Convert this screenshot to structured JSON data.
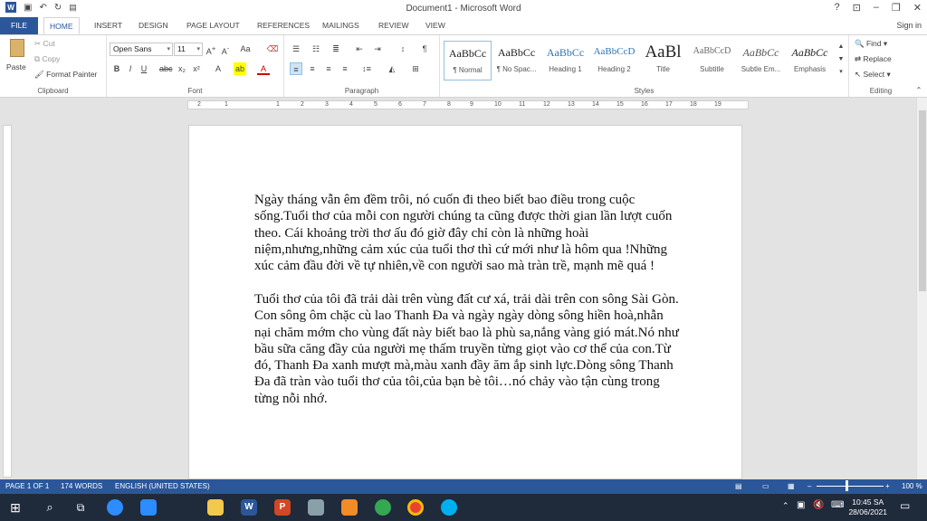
{
  "window": {
    "title": "Document1 - Microsoft Word",
    "help": "?",
    "sign_in": "Sign in"
  },
  "tabs": [
    "FILE",
    "HOME",
    "INSERT",
    "DESIGN",
    "PAGE LAYOUT",
    "REFERENCES",
    "MAILINGS",
    "REVIEW",
    "VIEW"
  ],
  "ribbon": {
    "clipboard": {
      "paste": "Paste",
      "cut": "Cut",
      "copy": "Copy",
      "format_painter": "Format Painter",
      "label": "Clipboard"
    },
    "font": {
      "name": "Open Sans",
      "size": "11",
      "label": "Font"
    },
    "paragraph": {
      "label": "Paragraph"
    },
    "styles": {
      "label": "Styles",
      "items": [
        {
          "sample": "AaBbCc",
          "name": "¶ Normal"
        },
        {
          "sample": "AaBbCc",
          "name": "¶ No Spac..."
        },
        {
          "sample": "AaBbCc",
          "name": "Heading 1"
        },
        {
          "sample": "AaBbCcD",
          "name": "Heading 2"
        },
        {
          "sample": "AaBl",
          "name": "Title"
        },
        {
          "sample": "AaBbCcD",
          "name": "Subtitle"
        },
        {
          "sample": "AaBbCc",
          "name": "Subtle Em..."
        },
        {
          "sample": "AaBbCc",
          "name": "Emphasis"
        }
      ]
    },
    "editing": {
      "find": "Find",
      "replace": "Replace",
      "select": "Select",
      "label": "Editing"
    }
  },
  "ruler_numbers": [
    "2",
    "1",
    "1",
    "2",
    "3",
    "4",
    "5",
    "6",
    "7",
    "8",
    "9",
    "10",
    "11",
    "12",
    "13",
    "14",
    "15",
    "16",
    "17",
    "18",
    "19"
  ],
  "document": {
    "paragraph1": "Ngày tháng vẫn êm đềm trôi, nó cuốn đi theo biết bao điều trong cuộc sống.Tuổi thơ của mỗi con người chúng ta cũng được thời gian lần lượt cuốn theo. Cái khoảng trời thơ ấu đó giờ đây chỉ còn là những hoài niệm,nhưng,những cảm xúc của tuổi thơ thì cứ mới như là hôm qua !Những xúc cảm đầu đời về tự nhiên,về con người sao mà tràn trề, mạnh mẽ quá !",
    "paragraph2": "Tuổi thơ của tôi đã trải dài trên vùng đất cư xá, trải dài trên con sông Sài Gòn. Con sông ôm chặc cù lao Thanh Đa và ngày ngày dòng sông hiền hoà,nhẫn nại chăm mớm cho vùng đất này biết bao là phù sa,nắng vàng gió mát.Nó như bầu sữa căng đầy của người mẹ thấm truyền từng giọt vào cơ thể của con.Từ đó, Thanh Đa xanh mượt mà,màu xanh đầy ăm ắp sinh lực.Dòng sông Thanh Đa đã tràn vào tuổi thơ của tôi,của bạn bè tôi…nó chảy vào tận cùng trong từng nỗi nhớ."
  },
  "status": {
    "page": "PAGE 1 OF 1",
    "words": "174 WORDS",
    "language": "ENGLISH (UNITED STATES)",
    "zoom": "100 %"
  },
  "taskbar": {
    "time": "10:45 SA",
    "date": "28/06/2021"
  },
  "colors": {
    "accent": "#2b579a",
    "taskbar": "#1f2a3b"
  }
}
